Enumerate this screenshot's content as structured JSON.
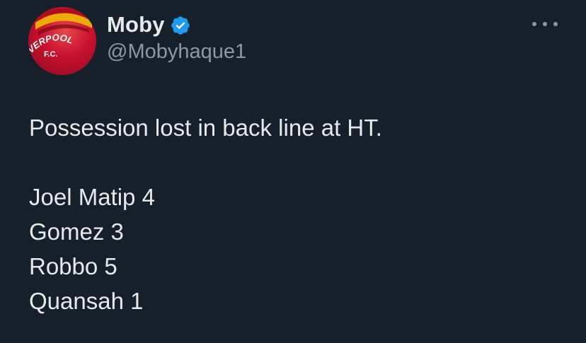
{
  "author": {
    "name": "Moby",
    "handle": "@Mobyhaque1",
    "verified": true,
    "avatar_text_top": "VERPOOL",
    "avatar_text_bottom": "F.C."
  },
  "icons": {
    "verified": "verified-badge-icon",
    "more": "more-options-icon"
  },
  "colors": {
    "background": "#15202b",
    "text": "#e7e9ea",
    "secondary": "#8b98a5",
    "verified": "#1d9bf0",
    "avatar_red": "#c8102e"
  },
  "tweet": {
    "intro": "Possession lost in back line at HT.",
    "lines": [
      "Joel Matip 4",
      "Gomez 3",
      "Robbo 5",
      "Quansah 1"
    ]
  }
}
